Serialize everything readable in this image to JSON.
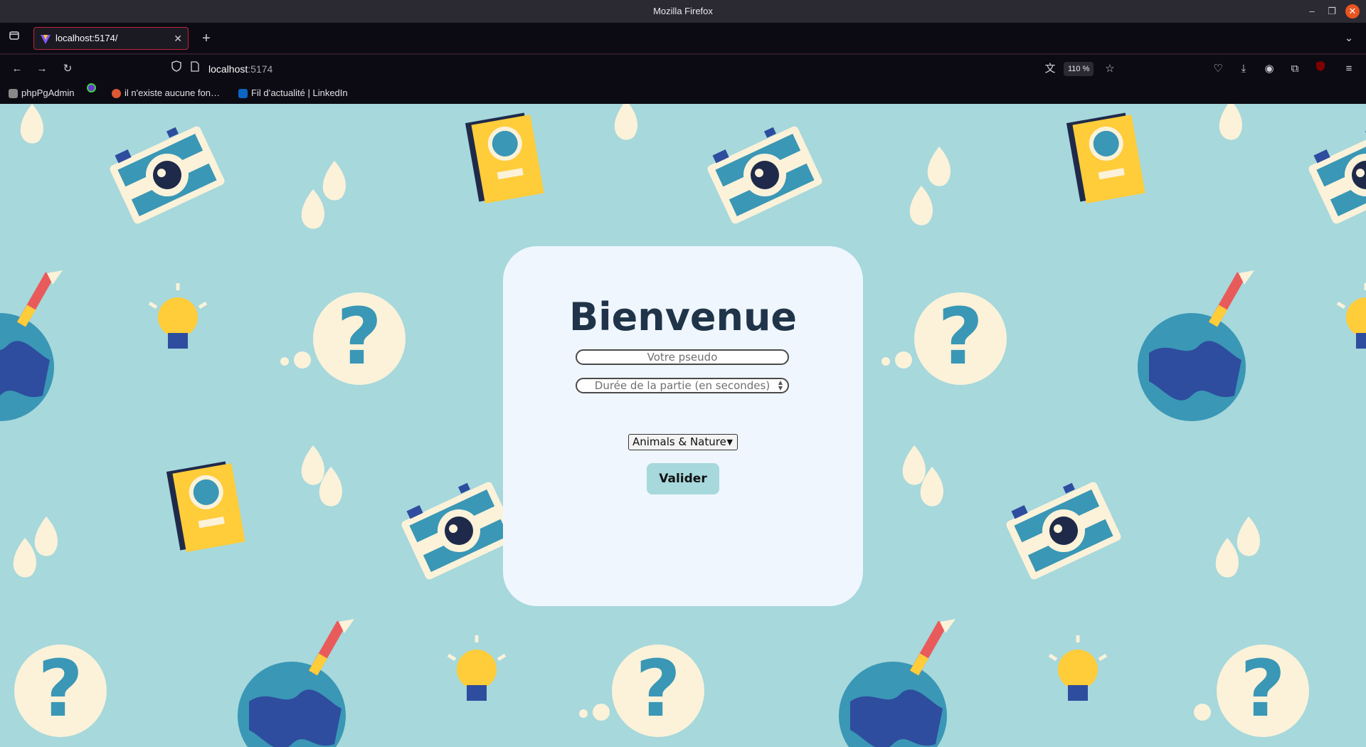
{
  "window": {
    "title": "Mozilla Firefox"
  },
  "tab": {
    "title": "localhost:5174/"
  },
  "navbar": {
    "url_host": "localhost",
    "url_port": ":5174",
    "zoom": "110 %"
  },
  "bookmarks": [
    {
      "label": "phpPgAdmin"
    },
    {
      "label": ""
    },
    {
      "label": "il n'existe aucune fon…"
    },
    {
      "label": "Fil d’actualité | LinkedIn"
    }
  ],
  "form": {
    "title": "Bienvenue",
    "pseudo_placeholder": "Votre pseudo",
    "duration_placeholder": "Durée de la partie (en secondes)",
    "category_selected": "Animals & Nature",
    "submit_label": "Valider"
  },
  "colors": {
    "background": "#a6d8dc",
    "card": "#eff6fd",
    "heading": "#1f3448",
    "accent": "#c0243d"
  }
}
